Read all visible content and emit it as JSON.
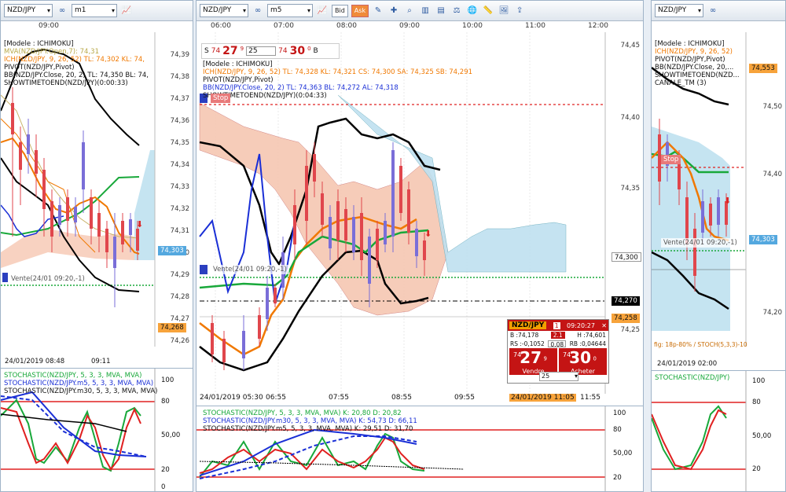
{
  "left": {
    "symbol": "NZD/JPY",
    "period": "m1",
    "time_top": "09:00",
    "info": [
      "[Modele : ICHIMOKU]",
      "MVA(NZD/JPY.Open,7): 74,31",
      "ICH(NZD/JPY, 9, 26, 52)  TL: 74,302  KL: 74,",
      "PIVOT(NZD/JPY,Pivot)",
      "BB(NZD/JPY.Close, 20, 2)  TL: 74,350  BL: 74,",
      "SHOWTIMETOEND(NZD/JPY)(0:00:33)"
    ],
    "prices": [
      "74,39",
      "74,38",
      "74,37",
      "74,36",
      "74,35",
      "74,34",
      "74,33",
      "74,32",
      "74,31",
      "74,30",
      "74,29",
      "74,28",
      "74,27",
      "74,26"
    ],
    "tag_blue": "74,303",
    "tag_orange": "74,268",
    "vente": "Vente(24/01 09:20,-1)",
    "date_left": "24/01/2019 08:48",
    "date_right": "09:11",
    "osc": [
      "STOCHASTIC(NZD/JPY, 5, 3, 3, MVA, MVA)",
      "STOCHASTIC(NZD/JPY.m5, 5, 3, 3, MVA, MVA)",
      "STOCHASTIC(NZD/JPY.m30, 5, 3, 3, MVA, MVA)"
    ],
    "osc_scale": [
      "100",
      "80",
      "50,00",
      "20",
      "0"
    ]
  },
  "center": {
    "symbol": "NZD/JPY",
    "period": "m5",
    "bid": "Bid",
    "ask": "Ask",
    "times": [
      "06:00",
      "07:00",
      "08:00",
      "09:00",
      "10:00",
      "11:00",
      "12:00"
    ],
    "quote": {
      "s": "S",
      "s_big": "74",
      "s_price": "27",
      "s_sup": "9",
      "qty": "25",
      "b_big": "74",
      "b_price": "30",
      "b_sup": "0",
      "b": "B"
    },
    "info": [
      "[Modele : ICHIMOKU]",
      "ICH(NZD/JPY, 9, 26, 52)  TL: 74,328  KL: 74,321  CS: 74,300  SA: 74,325  SB: 74,291",
      "PIVOT(NZD/JPY,Pivot)",
      "BB(NZD/JPY.Close, 20, 2)  TL: 74,363  BL: 74,272  AL: 74,318",
      "SHOWTIMETOEND(NZD/JPY)(0:04:33)"
    ],
    "stop": "Stop",
    "prices": [
      "74,45",
      "74,40",
      "74,35",
      "74,30",
      "74,25"
    ],
    "tag_300": "74,300",
    "tag_270": "74,270",
    "tag_258": "74,258",
    "vente": "Vente(24/01 09:20,-1)",
    "dates": [
      "24/01/2019 05:30",
      "06:55",
      "07:55",
      "08:55",
      "09:55",
      "11:55"
    ],
    "date_highlight": "24/01/2019 11:05",
    "osc": [
      "STOCHASTIC(NZD/JPY, 5, 3, 3, MVA, MVA)  K: 20,80  D: 20,82",
      "STOCHASTIC(NZD/JPY.m30, 5, 3, 3, MVA, MVA)  K: 54,73  D: 66,11",
      "STOCHASTIC(NZD/JPY.m5, 5, 3, 3, MVA, MVA)  K: 29,51  D: 31,70"
    ],
    "osc_scale": [
      "100",
      "80",
      "50,00",
      "20"
    ]
  },
  "trade": {
    "symbol": "NZD/JPY",
    "badge": "1",
    "time": "09:20:27",
    "b": "B :74,178",
    "spread": "2.1",
    "h": "H :74,601",
    "rs": "RS :-0,1052",
    "mid": "0.08",
    "rb": "RB :0,04644",
    "sell_small": "74",
    "sell_big": "27",
    "sell_sup": "9",
    "sell_cap": "Vendre",
    "qty": "25",
    "buy_small": "74",
    "buy_big": "30",
    "buy_sup": "0",
    "buy_cap": "Acheter"
  },
  "right": {
    "symbol": "NZD/JPY",
    "info": [
      "[Modele : ICHIMOKU]",
      "ICH(NZD/JPY, 9, 26, 52)",
      "PIVOT(NZD/JPY,Pivot)",
      "BB(NZD/JPY.Close, 20,...",
      "SHOWTIMETOEND(NZD...",
      "CANALE_TM (3)"
    ],
    "prices": [
      "74,50",
      "74,40",
      "74,30",
      "74,20"
    ],
    "tag_553": "74,553",
    "tag_303": "74,303",
    "stop": "Stop",
    "vente": "Vente(24/01 09:20,-1)",
    "fig_note": "fig: 18p-80% / STOCH(5,3,3)-10",
    "date": "24/01/2019 02:00",
    "osc": [
      "STOCHASTIC(NZD/JPY)"
    ],
    "osc_scale": [
      "100",
      "80",
      "50,00",
      "20"
    ]
  },
  "colors": {
    "orange": "#f07800",
    "green": "#18a83a",
    "blue": "#1a2fd6",
    "black": "#000000",
    "cloud_red": "#f6c7b2",
    "cloud_blue": "#bfe1f0",
    "tag_orange": "#f7a33b",
    "tag_blue": "#54a8df",
    "red_candle": "#e0464c",
    "blue_candle": "#7a6ed8"
  }
}
